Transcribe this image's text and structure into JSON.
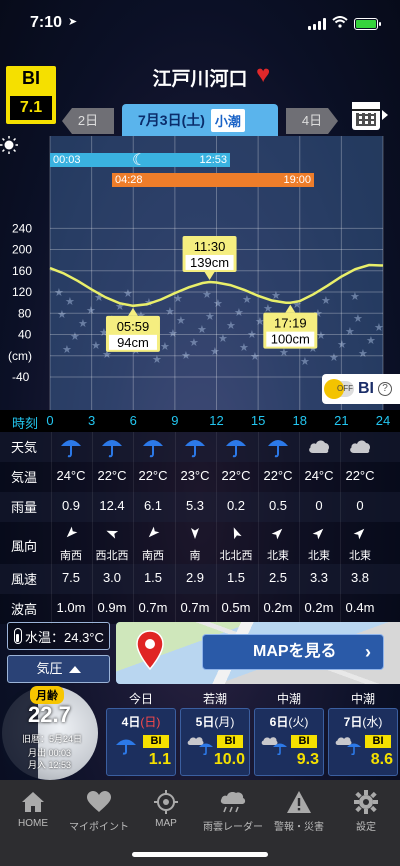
{
  "status": {
    "time": "7:10",
    "location_icon": "location-arrow-icon"
  },
  "header": {
    "bi_label": "BI",
    "bi_value": "7.1",
    "title": "江戸川河口",
    "favorite_icon": "heart-icon"
  },
  "tabs": {
    "prev": "2日",
    "current_date": "7月3日(土)",
    "tide_type": "小潮",
    "next": "4日"
  },
  "moon_times": {
    "rise": "00:03",
    "set": "12:53"
  },
  "sun_times": {
    "rise": "04:28",
    "set": "19:00"
  },
  "toggle": {
    "state": "OFF",
    "label": "BI",
    "help": "?"
  },
  "chart_data": {
    "type": "line",
    "ylabel": "(cm)",
    "yticks": [
      "240",
      "200",
      "160",
      "120",
      "80",
      "40",
      "(cm)",
      "-40"
    ],
    "ylim": [
      -50,
      260
    ],
    "x": [
      0,
      1,
      2,
      3,
      4,
      5,
      5.98,
      7,
      8,
      9,
      10,
      11,
      11.5,
      12,
      13,
      14,
      15,
      16,
      17,
      17.32,
      18,
      19,
      20,
      21,
      22,
      23,
      24
    ],
    "values": [
      165,
      155,
      141,
      125,
      110,
      99,
      94,
      97,
      106,
      118,
      129,
      137,
      139,
      138,
      133,
      124,
      113,
      104,
      100,
      100,
      103,
      116,
      132,
      149,
      163,
      171,
      170
    ],
    "annotations": [
      {
        "time": "05:59",
        "value": "94cm"
      },
      {
        "time": "11:30",
        "value": "139cm"
      },
      {
        "time": "17:19",
        "value": "100cm"
      }
    ]
  },
  "hours": {
    "label": "時刻",
    "ticks": [
      "0",
      "3",
      "6",
      "9",
      "12",
      "15",
      "18",
      "21",
      "24"
    ]
  },
  "weather": {
    "labels": {
      "weather": "天気",
      "temp": "気温",
      "rain": "雨量",
      "wind_dir": "風向",
      "wind_speed": "風速",
      "wave": "波高"
    },
    "icons": [
      "umbrella-icon",
      "umbrella-icon",
      "umbrella-icon",
      "umbrella-icon",
      "umbrella-icon",
      "umbrella-icon",
      "cloud-icon",
      "cloud-icon"
    ],
    "temps": [
      "24°C",
      "22°C",
      "22°C",
      "23°C",
      "22°C",
      "22°C",
      "24°C",
      "22°C"
    ],
    "rain": [
      "0.9",
      "12.4",
      "6.1",
      "5.3",
      "0.2",
      "0.5",
      "0",
      "0"
    ],
    "wind_dirs": [
      "南西",
      "西北西",
      "南西",
      "南",
      "北北西",
      "北東",
      "北東",
      "北東"
    ],
    "wind_speeds": [
      "7.5",
      "3.0",
      "1.5",
      "2.9",
      "1.5",
      "2.5",
      "3.3",
      "3.8"
    ],
    "waves": [
      "1.0m",
      "0.9m",
      "0.7m",
      "0.7m",
      "0.5m",
      "0.2m",
      "0.2m",
      "0.4m"
    ]
  },
  "water_temp": "水温：24.3°C",
  "pressure": "気圧",
  "map": {
    "button": "MAPを見る"
  },
  "moon": {
    "label": "月齢",
    "age": "22.7",
    "old_calendar": "旧暦：5月24日",
    "rise": "月出 00:03",
    "set": "月入 12:53"
  },
  "days": [
    {
      "top": "今日",
      "day": "4日",
      "wk": "(日)",
      "bi": "BI",
      "value": "1.1",
      "icon": "umbrella-icon"
    },
    {
      "top": "若潮",
      "day": "5日",
      "wk": "(月)",
      "bi": "BI",
      "value": "10.0",
      "icon": "cloud-umbrella-icon"
    },
    {
      "top": "中潮",
      "day": "6日",
      "wk": "(火)",
      "bi": "BI",
      "value": "9.3",
      "icon": "cloud-umbrella-icon"
    },
    {
      "top": "中潮",
      "day": "7日",
      "wk": "(水)",
      "bi": "BI",
      "value": "8.6",
      "icon": "cloud-umbrella-icon"
    }
  ],
  "nav": [
    {
      "label": "HOME"
    },
    {
      "label": "マイポイント"
    },
    {
      "label": "MAP"
    },
    {
      "label": "雨雲レーダー"
    },
    {
      "label": "警報・災害"
    },
    {
      "label": "設定"
    }
  ],
  "colors": {
    "accent": "#f5e000",
    "tab": "#5ab4ec",
    "tide_line": "#e9ef6a",
    "hour_text": "#23c6f0"
  }
}
